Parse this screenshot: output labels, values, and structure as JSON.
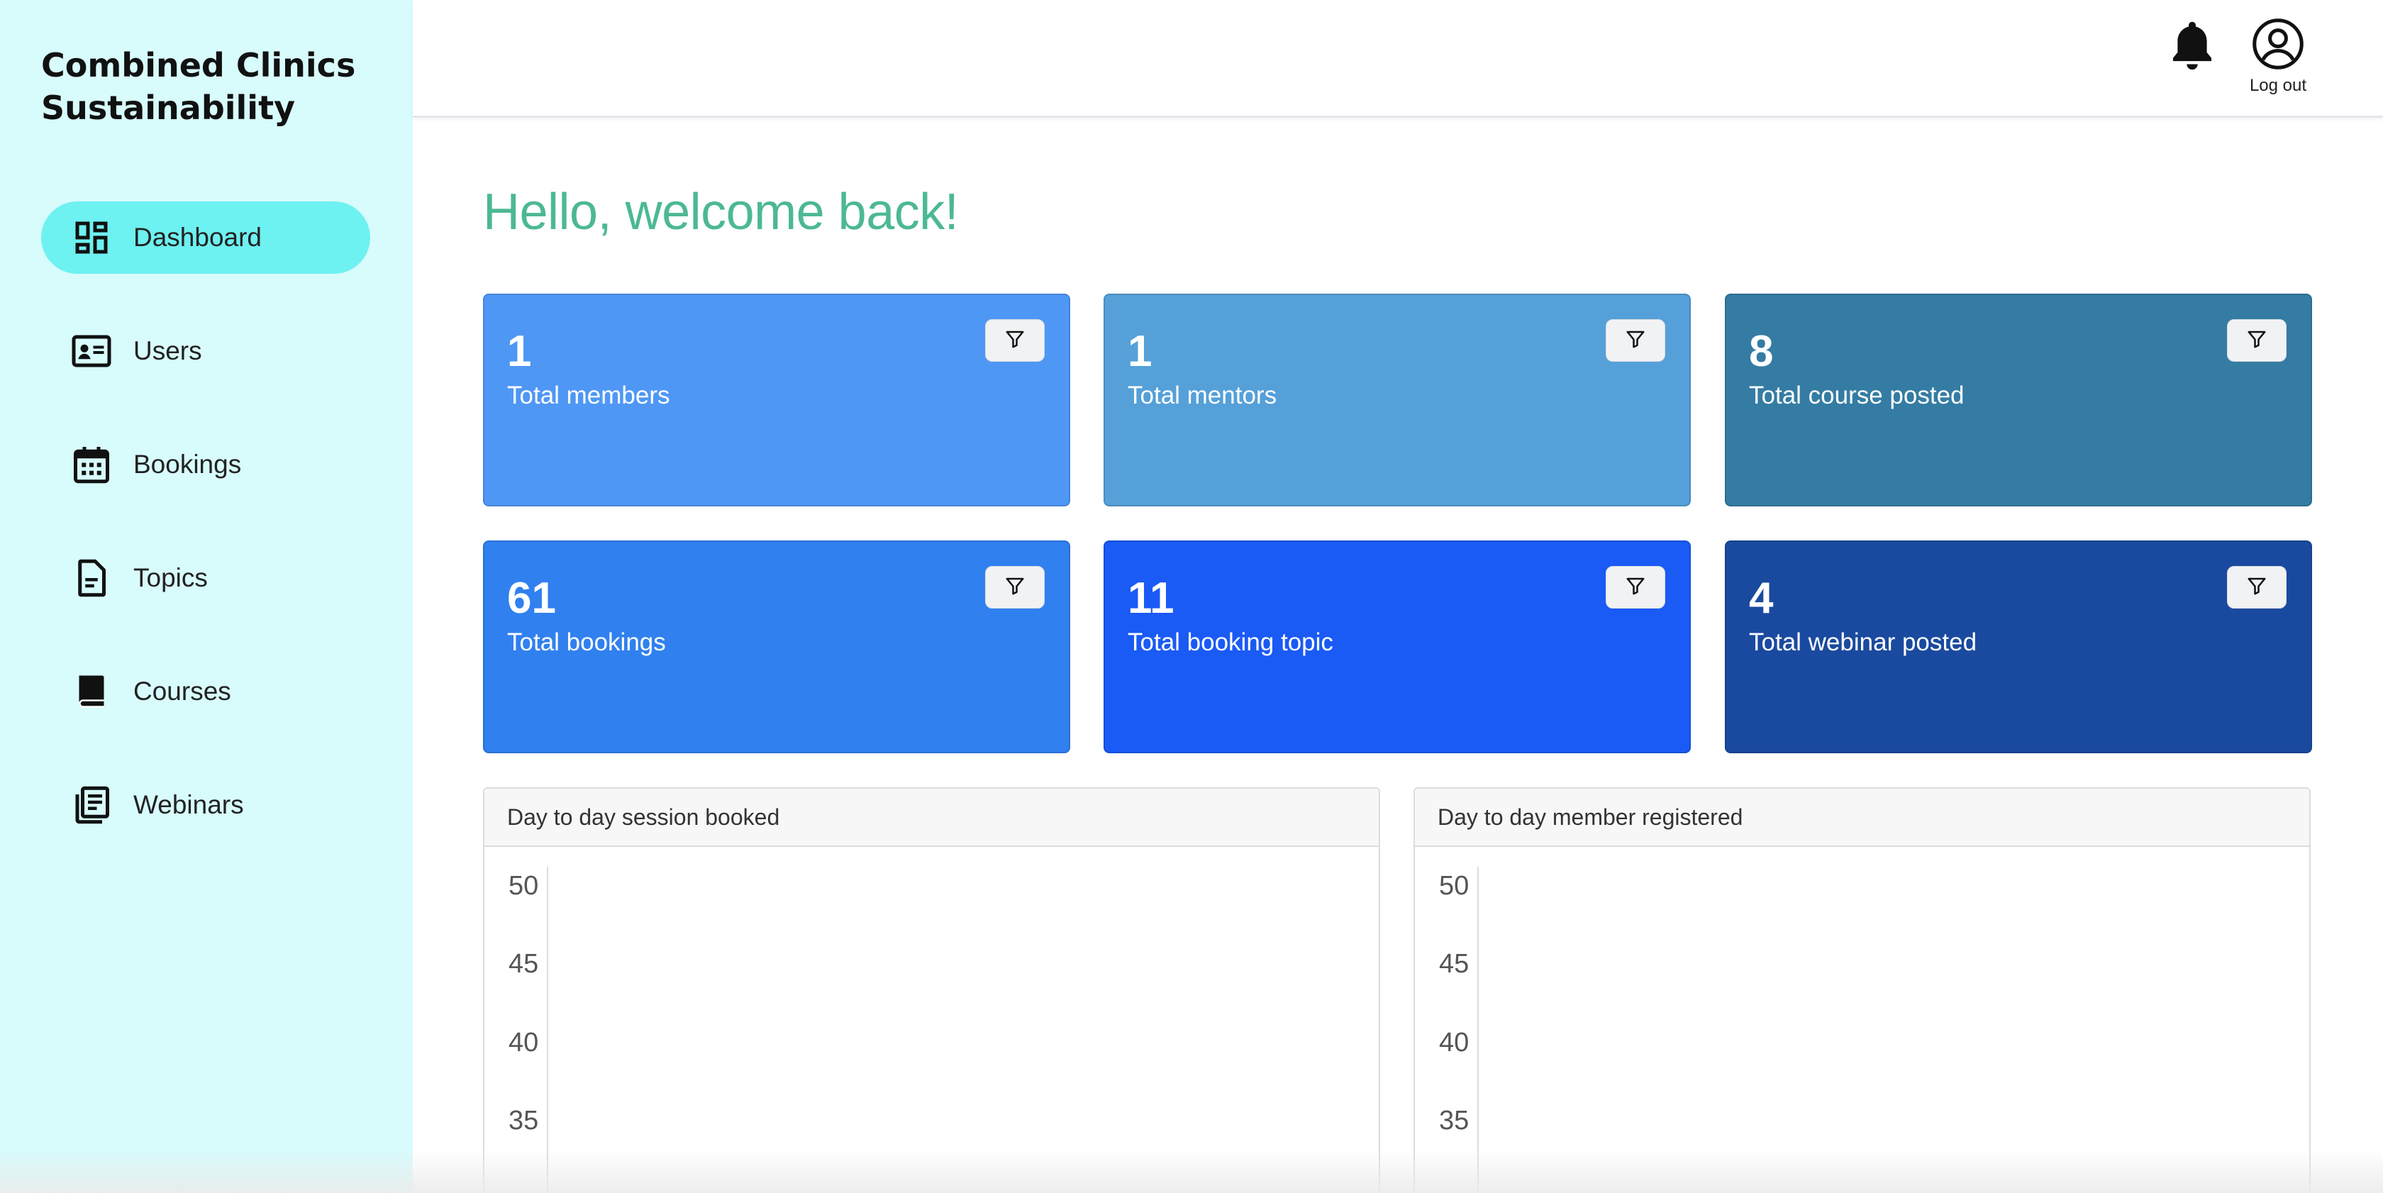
{
  "brand": {
    "title": "Combined Clinics Sustainability"
  },
  "sidebar": {
    "items": [
      {
        "label": "Dashboard",
        "icon": "dashboard-icon",
        "active": true
      },
      {
        "label": "Users",
        "icon": "id-card-icon",
        "active": false
      },
      {
        "label": "Bookings",
        "icon": "calendar-icon",
        "active": false
      },
      {
        "label": "Topics",
        "icon": "document-icon",
        "active": false
      },
      {
        "label": "Courses",
        "icon": "book-icon",
        "active": false
      },
      {
        "label": "Webinars",
        "icon": "newspaper-icon",
        "active": false
      }
    ]
  },
  "topbar": {
    "notification_icon": "bell-icon",
    "logout_icon": "user-circle-icon",
    "logout_label": "Log out"
  },
  "main": {
    "welcome": "Hello, welcome back!",
    "cards": [
      {
        "value": "1",
        "label": "Total members",
        "color": "#4f97f5"
      },
      {
        "value": "1",
        "label": "Total mentors",
        "color": "#55a0d8"
      },
      {
        "value": "8",
        "label": "Total course posted",
        "color": "#347ca3"
      },
      {
        "value": "61",
        "label": "Total bookings",
        "color": "#3080f0"
      },
      {
        "value": "11",
        "label": "Total booking topic",
        "color": "#1a5af5"
      },
      {
        "value": "4",
        "label": "Total webinar posted",
        "color": "#1a4a9f"
      }
    ],
    "charts": [
      {
        "title": "Day to day session booked",
        "y_ticks": [
          "50",
          "45",
          "40",
          "35"
        ]
      },
      {
        "title": "Day to day member registered",
        "y_ticks": [
          "50",
          "45",
          "40",
          "35"
        ]
      }
    ]
  },
  "colors": {
    "sidebar_bg": "#d8fbfc",
    "active_nav": "#6ef1f1",
    "welcome_text": "#4cb894"
  }
}
